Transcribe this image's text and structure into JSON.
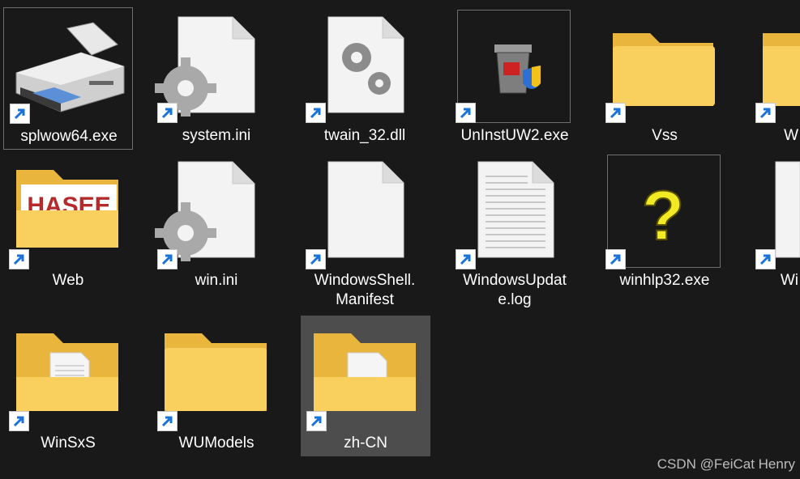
{
  "files": [
    {
      "label": "splwow64.exe",
      "icon": "printer-icon",
      "state": "bordered"
    },
    {
      "label": "system.ini",
      "icon": "settings-file-icon"
    },
    {
      "label": "twain_32.dll",
      "icon": "dll-gears-icon"
    },
    {
      "label": "UnInstUW2.exe",
      "icon": "uninstall-trash-shield-icon"
    },
    {
      "label": "Vss",
      "icon": "folder-icon"
    },
    {
      "label": "W",
      "icon": "folder-icon"
    },
    {
      "label": "Web",
      "icon": "folder-hasee-icon"
    },
    {
      "label": "win.ini",
      "icon": "settings-file-icon"
    },
    {
      "label": "WindowsShell.\nManifest",
      "icon": "blank-file-icon"
    },
    {
      "label": "WindowsUpdat\ne.log",
      "icon": "text-file-icon"
    },
    {
      "label": "winhlp32.exe",
      "icon": "help-question-icon"
    },
    {
      "label": "Wi",
      "icon": "blank-file-icon"
    },
    {
      "label": "WinSxS",
      "icon": "folder-with-document-icon"
    },
    {
      "label": "WUModels",
      "icon": "folder-icon"
    },
    {
      "label": "zh-CN",
      "icon": "folder-with-document-icon",
      "state": "selected"
    }
  ],
  "web_folder_logo_text": "HASEE",
  "watermark": "CSDN @FeiCat Henry",
  "colors": {
    "background": "#191919",
    "folder": "#f7c74e",
    "shortcut_arrow": "#1a73d9",
    "selected_bg": "#4d4d4d"
  }
}
